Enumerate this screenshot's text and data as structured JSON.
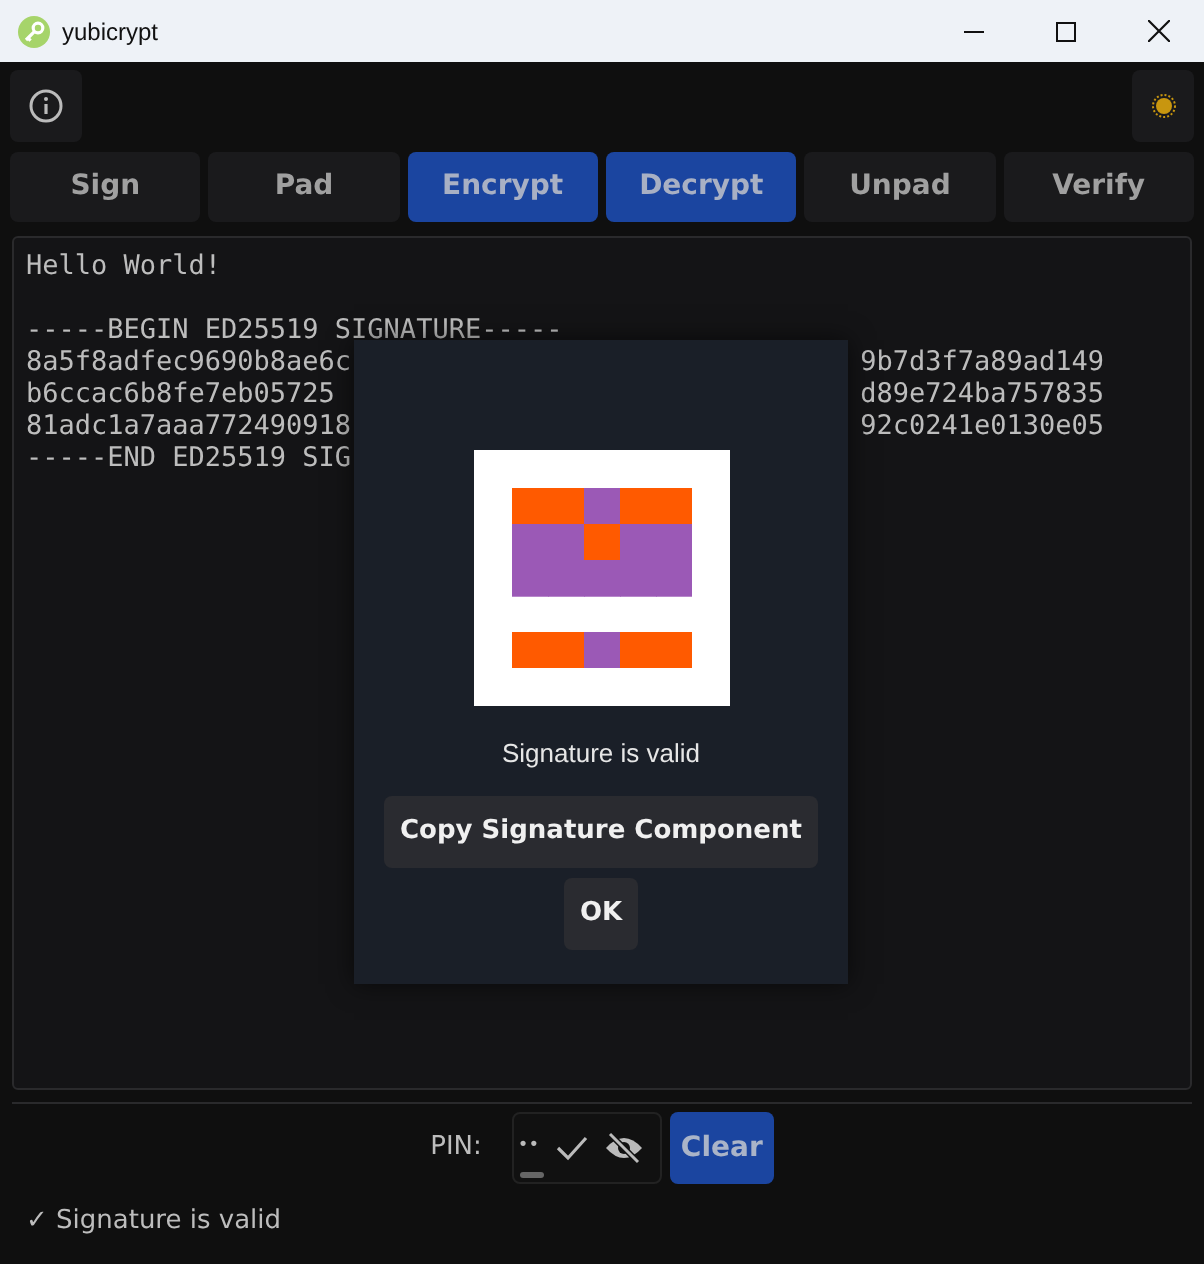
{
  "window": {
    "title": "yubicrypt"
  },
  "tabs": [
    {
      "label": "Sign",
      "selected": false
    },
    {
      "label": "Pad",
      "selected": false
    },
    {
      "label": "Encrypt",
      "selected": true
    },
    {
      "label": "Decrypt",
      "selected": true
    },
    {
      "label": "Unpad",
      "selected": false
    },
    {
      "label": "Verify",
      "selected": false
    }
  ],
  "editor": {
    "blocks": [
      {
        "lines": [
          {
            "left": "Hello World!"
          }
        ]
      },
      {
        "lines": [
          {
            "left": "-----BEGIN ED25519 SIGNATURE-----"
          },
          {
            "left": "8a5f8adfec9690b8ae6c",
            "right": "9b7d3f7a89ad149"
          },
          {
            "left": "b6ccac6b8fe7eb05725",
            "right": "d89e724ba757835"
          },
          {
            "left": "81adc1a7aaa772490918",
            "right": "92c0241e0130e05"
          },
          {
            "left": "-----END ED25519 SIG"
          }
        ]
      }
    ]
  },
  "dialog": {
    "message": "Signature is valid",
    "buttons": [
      "Copy Signature Component",
      "OK"
    ]
  },
  "pin": {
    "label": "PIN:",
    "value": "••",
    "clear": "Clear"
  },
  "status": "✓ Signature is valid"
}
